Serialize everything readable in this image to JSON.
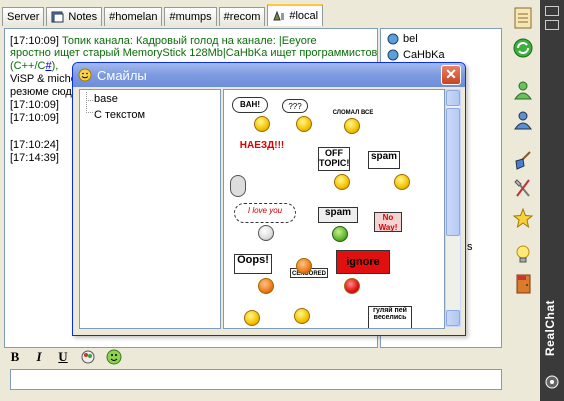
{
  "tabs": [
    {
      "label": "Server",
      "icon": "none"
    },
    {
      "label": "Notes",
      "icon": "notes-icon"
    },
    {
      "label": "#homelan",
      "icon": "none"
    },
    {
      "label": "#mumps",
      "icon": "none"
    },
    {
      "label": "#recom",
      "icon": "none"
    },
    {
      "label": "#local",
      "icon": "channel-icon"
    }
  ],
  "chat": {
    "line1_time": "[17:10:09]",
    "line1_topic": "Топик канала: Кадровый голод на канале: |Eeyore",
    "line2": "яростно ищет старый MemoryStick 128Mb|CaHbKa ищет программистов",
    "line3_a": "(C++/C",
    "line3_link": "#",
    "line3_b": "),",
    "line4": "ViSP & miche",
    "line5": "резюме сюд",
    "line6": "[17:10:09]",
    "line7": "[17:10:09]",
    "line8": "[17:10:24]",
    "line9": "[17:14:39]"
  },
  "users": [
    "bel",
    "CaHbKa"
  ],
  "users_extra": "s",
  "dialog": {
    "title": "Смайлы",
    "tree": [
      "base",
      "С текстом"
    ],
    "signs": {
      "bah": "BAH!",
      "qqq": "???",
      "slomal": "СЛОМАЛ ВСЕ",
      "naezd": "НАЕЗД!!!",
      "offtopic": "OFF TOPIC!",
      "spam1": "spam",
      "love": "I love you",
      "spam2": "spam",
      "noway": "No Way!",
      "oops": "Oops!",
      "censored": "CENSORED",
      "ignore": "ignore",
      "gulyai": "гуляй пей веселись"
    }
  },
  "format": {
    "bold": "B",
    "italic": "I",
    "underline": "U"
  },
  "brand": {
    "name": "RealChat"
  },
  "colors": {
    "accent": "#0831d9",
    "topic": "#0a6e0a",
    "link": "#0000cc"
  }
}
